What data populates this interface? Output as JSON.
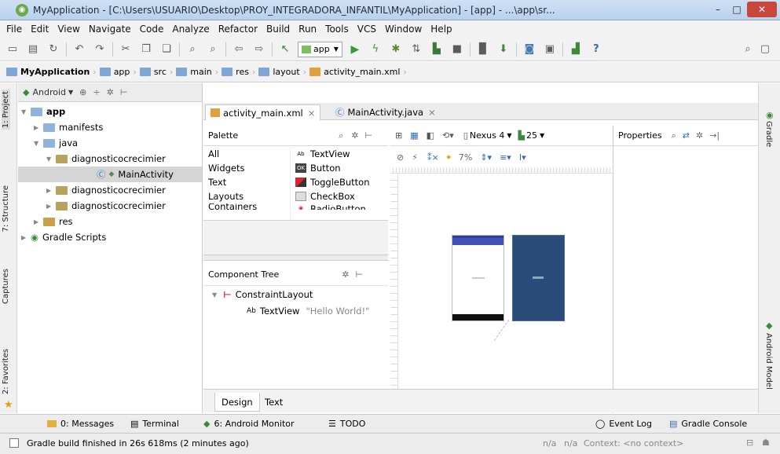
{
  "window": {
    "title": "MyApplication - [C:\\Users\\USUARIO\\Desktop\\PROY_INTEGRADORA_INFANTIL\\MyApplication] - [app] - ...\\app\\sr...",
    "minimize": "–",
    "maximize": "□",
    "close": "✕"
  },
  "menu": [
    "File",
    "Edit",
    "View",
    "Navigate",
    "Code",
    "Analyze",
    "Refactor",
    "Build",
    "Run",
    "Tools",
    "VCS",
    "Window",
    "Help"
  ],
  "toolbar": {
    "run_config": "app"
  },
  "breadcrumbs": [
    "MyApplication",
    "app",
    "src",
    "main",
    "res",
    "layout",
    "activity_main.xml"
  ],
  "left_tools": [
    "1: Project",
    "7: Structure",
    "Captures",
    "2: Favorites"
  ],
  "right_tools": [
    "Gradle",
    "Android Model"
  ],
  "project": {
    "view_mode": "Android",
    "tree": [
      {
        "label": "app",
        "level": 0
      },
      {
        "label": "manifests",
        "level": 1
      },
      {
        "label": "java",
        "level": 1
      },
      {
        "label": "diagnosticocrecimier",
        "level": 2
      },
      {
        "label": "MainActivity",
        "level": 3
      },
      {
        "label": "diagnosticocrecimier",
        "level": 2
      },
      {
        "label": "diagnosticocrecimier",
        "level": 2
      },
      {
        "label": "res",
        "level": 1
      },
      {
        "label": "Gradle Scripts",
        "level": 0
      }
    ]
  },
  "editor_tabs": [
    {
      "label": "activity_main.xml",
      "active": true
    },
    {
      "label": "MainActivity.java",
      "active": false
    }
  ],
  "palette": {
    "title": "Palette",
    "categories": [
      "All",
      "Widgets",
      "Text",
      "Layouts",
      "Containers"
    ],
    "items": [
      "TextView",
      "Button",
      "ToggleButton",
      "CheckBox",
      "RadioButton"
    ],
    "item_badges": {
      "text": "Ab",
      "button": "OK"
    }
  },
  "component_tree": {
    "title": "Component Tree",
    "root": "ConstraintLayout",
    "child": "TextView",
    "child_value": "\"Hello World!\"",
    "child_badge": "Ab"
  },
  "design_toolbar": {
    "device": "Nexus 4",
    "api": "25",
    "zoom": "7%"
  },
  "properties": {
    "title": "Properties"
  },
  "bottom_tabs": [
    "Design",
    "Text"
  ],
  "tool_windows": {
    "messages": "0: Messages",
    "terminal": "Terminal",
    "monitor": "6: Android Monitor",
    "todo": "TODO",
    "event_log": "Event Log",
    "gradle_console": "Gradle Console"
  },
  "status": {
    "message": "Gradle build finished in 26s 618ms (2 minutes ago)",
    "na1": "n/a",
    "na2": "n/a",
    "context": "Context: <no context>"
  },
  "colors": {
    "accent_blue": "#3f51b5",
    "blueprint": "#2b4b7a",
    "run_green": "#3a9a3a"
  }
}
